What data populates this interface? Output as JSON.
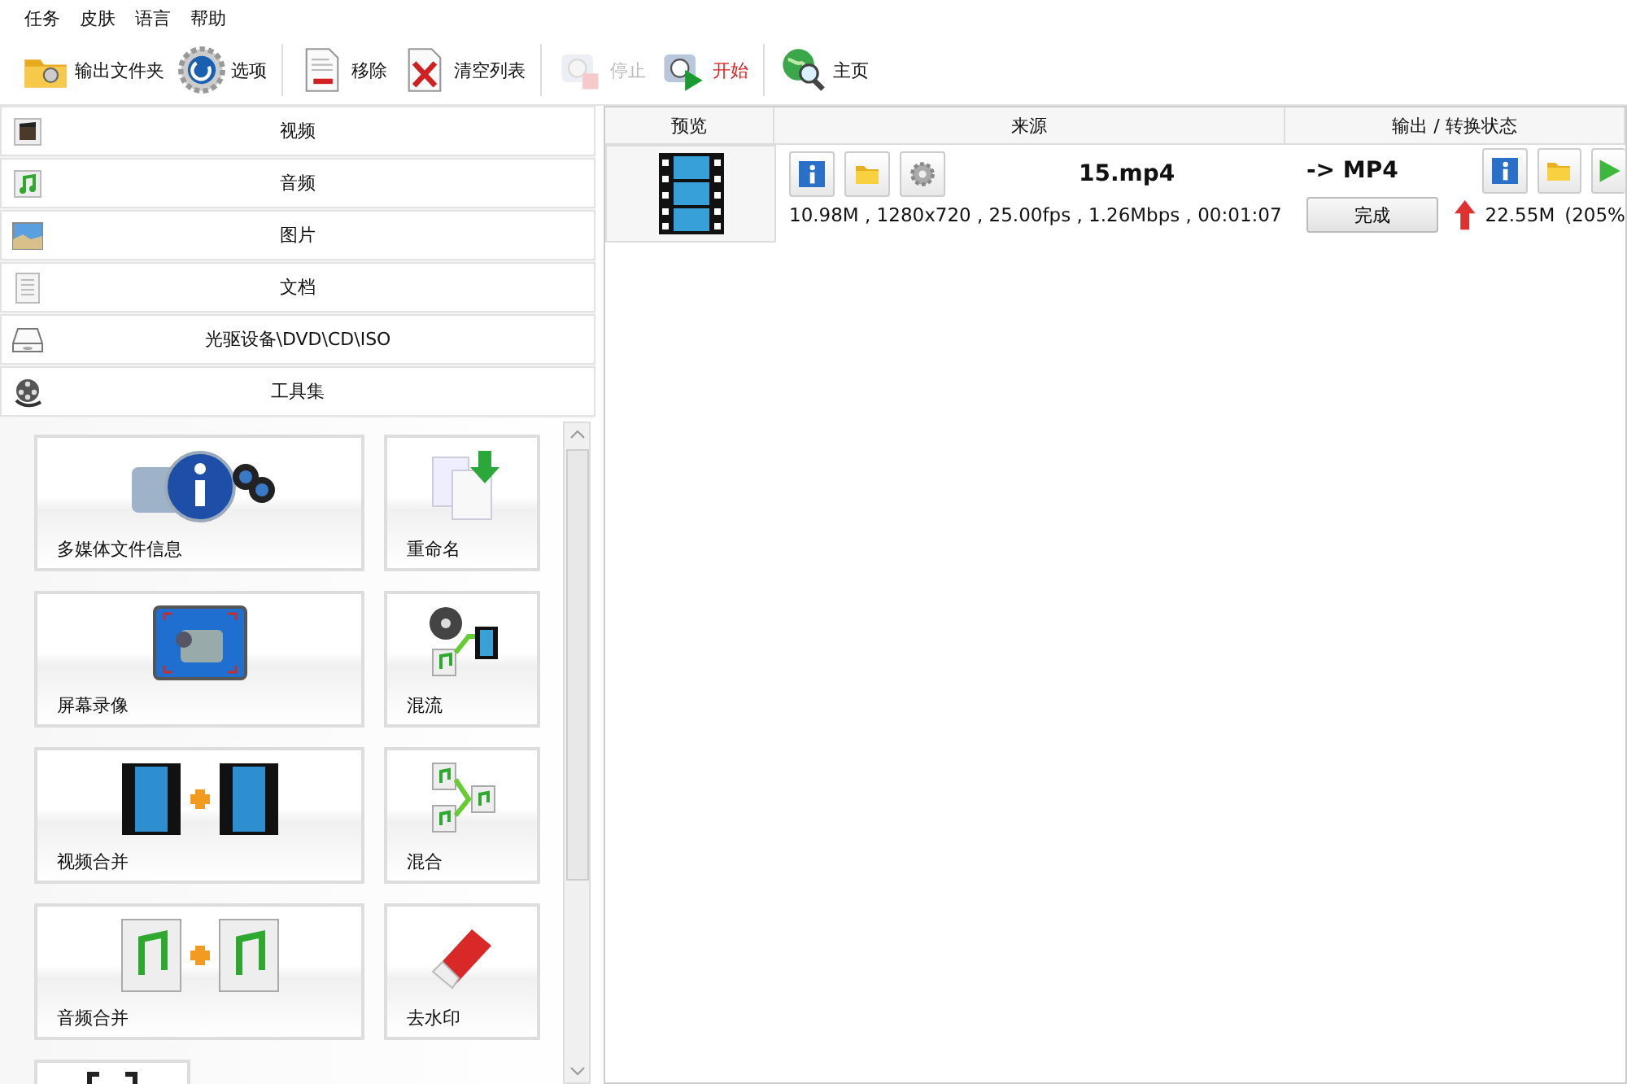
{
  "menu": [
    "任务",
    "皮肤",
    "语言",
    "帮助"
  ],
  "toolbar": [
    {
      "kind": "folder",
      "label": "输出文件夹",
      "disabled": false,
      "emphasis": false,
      "separator_before": false
    },
    {
      "kind": "gear",
      "label": "选项",
      "disabled": false,
      "emphasis": false,
      "separator_before": false
    },
    {
      "kind": "remove",
      "label": "移除",
      "disabled": false,
      "emphasis": false,
      "separator_before": true
    },
    {
      "kind": "clear",
      "label": "清空列表",
      "disabled": false,
      "emphasis": false,
      "separator_before": false
    },
    {
      "kind": "stop",
      "label": "停止",
      "disabled": true,
      "emphasis": false,
      "separator_before": true
    },
    {
      "kind": "start",
      "label": "开始",
      "disabled": false,
      "emphasis": true,
      "separator_before": false
    },
    {
      "kind": "globe",
      "label": "主页",
      "disabled": false,
      "emphasis": false,
      "separator_before": true
    }
  ],
  "categories": [
    {
      "kind": "video",
      "label": "视频"
    },
    {
      "kind": "audio",
      "label": "音频"
    },
    {
      "kind": "image",
      "label": "图片"
    },
    {
      "kind": "document",
      "label": "文档"
    },
    {
      "kind": "disc",
      "label": "光驱设备\\DVD\\CD\\ISO"
    },
    {
      "kind": "reel",
      "label": "工具集"
    }
  ],
  "tools": [
    {
      "kind": "info",
      "label": "多媒体文件信息"
    },
    {
      "kind": "rename",
      "label": "重命名"
    },
    {
      "kind": "record",
      "label": "屏幕录像"
    },
    {
      "kind": "mux",
      "label": "混流"
    },
    {
      "kind": "videojoin",
      "label": "视频合并"
    },
    {
      "kind": "mix",
      "label": "混合"
    },
    {
      "kind": "audiojoin",
      "label": "音频合并"
    },
    {
      "kind": "eraser",
      "label": "去水印"
    },
    {
      "kind": "crop"
    }
  ],
  "table": {
    "columns": [
      "预览",
      "来源",
      "输出 / 转换状态"
    ],
    "rows": [
      {
        "file": "15.mp4",
        "details": "10.98M , 1280x720 , 25.00fps , 1.26Mbps , 00:01:07",
        "target": "-> MP4",
        "status": "完成",
        "output_size": "22.55M",
        "ratio": "(205%"
      }
    ]
  }
}
